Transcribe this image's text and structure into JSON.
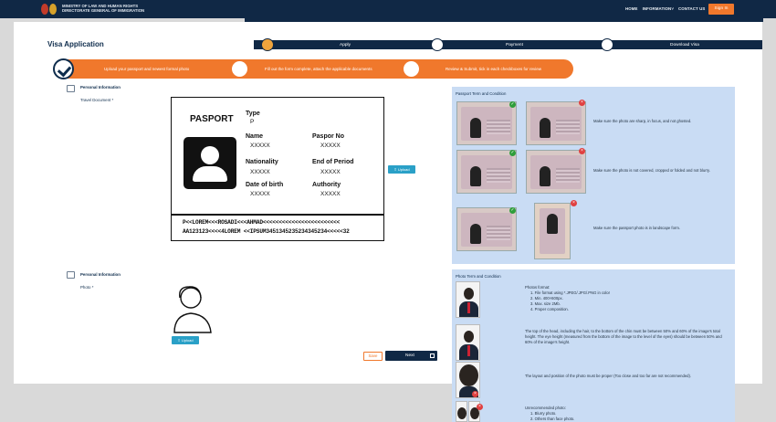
{
  "header": {
    "ministry_line1": "MINISTRY OF LAW AND HUMAN RIGHTS",
    "ministry_line2": "DIRECTORATE GENERAL OF IMMIGRATION",
    "nav": [
      "HOME",
      "INFORMATION",
      "CONTACT US"
    ],
    "nav_info_caret": "˅",
    "signin_label": "Sign In"
  },
  "page": {
    "title": "Visa Application"
  },
  "steps": [
    "Apply",
    "Payment",
    "Download Visa"
  ],
  "substeps": [
    "Upload your passport and newest formal photo",
    "Fill out the form complete, attach the applicable documents",
    "Review & Submit, tick in each checkboxes for review"
  ],
  "passport_section": {
    "header": "Personal Information",
    "field_label": "Travel Document *",
    "upload_label": "⇧ Upload"
  },
  "passport_card": {
    "heading": "PASPORT",
    "type_label": "Type",
    "type_value": "P",
    "name_label": "Name",
    "name_value": "XXXXX",
    "passport_no_label": "Paspor No",
    "passport_no_value": "XXXXX",
    "nationality_label": "Nationality",
    "nationality_value": "XXXXX",
    "end_period_label": "End of Period",
    "end_period_value": "XXXXX",
    "dob_label": "Date of birth",
    "dob_value": "XXXXX",
    "authority_label": "Authority",
    "authority_value": "XXXXX",
    "mrz_line1": "P<<LOREM<<<ROSADI<<<AHMAD<<<<<<<<<<<<<<<<<<<<<<<<",
    "mrz_line2": "AA123123<<<<4LOREM <<IPSUM3451345235234345234<<<<<32"
  },
  "passport_terms": {
    "title": "Passport Term and Condition",
    "rows": [
      "Make sure the photo are sharp, in focus, and not ghosted.",
      "Make sure the photo is not covered, cropped or folded and not blurry.",
      "Make sure the passport photo is in landscape form."
    ]
  },
  "photo_section": {
    "header": "Personal Information",
    "field_label": "Photo *",
    "upload_label": "⇧ Upload"
  },
  "photo_terms": {
    "title": "Photo Term and Condition",
    "format_title": "Photos format:",
    "format_items": [
      "1. File format using *.JPEG/.JPG/.PNG in color",
      "2. Min. 400×600px.",
      "3. Max. size 2Mb.",
      "4. Proper composition."
    ],
    "head_rule": "The top of the head, including the hair, to the bottom of the chin must be between 50% and 60% of the image's total height. The eye height (measured from the bottom of the image to the level of the eyes) should be between 50% and 60% of the image's height.",
    "layout_rule": "The layout and position of the photo must be proper (Too close and too far are not recommended).",
    "unrecommended_title": "Unrecommended photo:",
    "unrecommended_items": [
      "1. Blurry photo.",
      "2. Others than face photo."
    ]
  },
  "actions": {
    "save_label": "Save",
    "next_label": "Next"
  },
  "colors": {
    "navy": "#102845",
    "orange": "#f0782c",
    "panel_blue": "#c9dcf4",
    "upload_blue": "#2aa0c7"
  },
  "icons": {
    "check": "check-icon",
    "close": "close-x-icon",
    "user": "user-placeholder-icon",
    "upload": "upload-arrow-icon",
    "next": "next-arrow-icon"
  }
}
